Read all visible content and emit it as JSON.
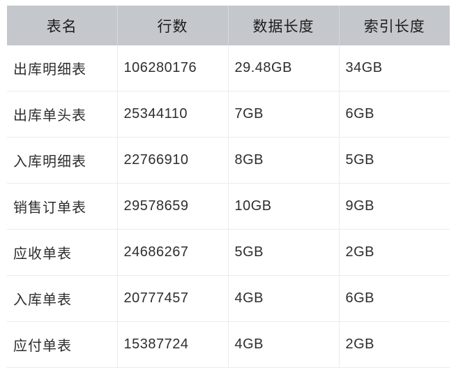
{
  "table": {
    "columns": [
      {
        "key": "name",
        "label": "表名"
      },
      {
        "key": "rows",
        "label": "行数"
      },
      {
        "key": "data",
        "label": "数据长度"
      },
      {
        "key": "index",
        "label": "索引长度"
      }
    ],
    "rows": [
      {
        "name": "出库明细表",
        "rows": "106280176",
        "data": "29.48GB",
        "index": "34GB"
      },
      {
        "name": "出库单头表",
        "rows": "25344110",
        "data": "7GB",
        "index": "6GB"
      },
      {
        "name": "入库明细表",
        "rows": "22766910",
        "data": "8GB",
        "index": "5GB"
      },
      {
        "name": "销售订单表",
        "rows": "29578659",
        "data": "10GB",
        "index": "9GB"
      },
      {
        "name": "应收单表",
        "rows": "24686267",
        "data": "5GB",
        "index": "2GB"
      },
      {
        "name": "入库单表",
        "rows": "20777457",
        "data": "4GB",
        "index": "6GB"
      },
      {
        "name": "应付单表",
        "rows": "15387724",
        "data": "4GB",
        "index": "2GB"
      }
    ],
    "colors": {
      "header_background": "#c4c8cd",
      "header_text": "#1c1c1c",
      "body_text": "#2e2e2e",
      "grid_line": "#ebebeb",
      "page_background": "#ffffff"
    }
  }
}
